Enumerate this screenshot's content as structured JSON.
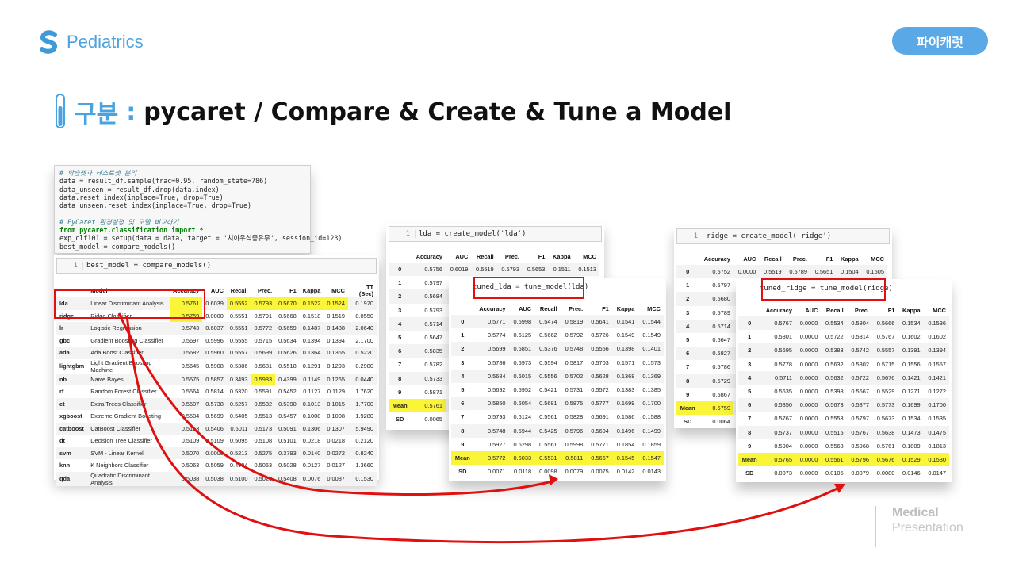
{
  "brand": {
    "name": "Pediatrics",
    "badge": "파이캐럿"
  },
  "title": {
    "category": "구분",
    "separator": ":",
    "main": "pycaret / Compare & Create & Tune a Model"
  },
  "footer": {
    "line1": "Medical",
    "line2": "Presentation"
  },
  "code_setup": [
    "# 학습셋과 테스트셋 분리",
    "data = result_df.sample(frac=0.95, random_state=786)",
    "data_unseen = result_df.drop(data.index)",
    "data.reset_index(inplace=True, drop=True)",
    "data_unseen.reset_index(inplace=True, drop=True)",
    "",
    "# PyCaret 환경설정 및 모델 비교하기",
    "from pycaret.classification import *",
    "exp_clf101 = setup(data = data, target = '치아우식증유무', session_id=123)",
    "best_model = compare_models()"
  ],
  "compare": {
    "cell_number": "1",
    "cell": "best_model = compare_models()",
    "columns": [
      "Model",
      "Accuracy",
      "AUC",
      "Recall",
      "Prec.",
      "F1",
      "Kappa",
      "MCC",
      "TT (Sec)"
    ],
    "rows": [
      [
        "lda",
        "Linear Discriminant Analysis",
        "0.5761",
        "0.6039",
        "0.5552",
        "0.5793",
        "0.5670",
        "0.1522",
        "0.1524",
        "0.1970"
      ],
      [
        "ridge",
        "Ridge Classifier",
        "0.5759",
        "0.0000",
        "0.5551",
        "0.5791",
        "0.5668",
        "0.1518",
        "0.1519",
        "0.0550"
      ],
      [
        "lr",
        "Logistic Regression",
        "0.5743",
        "0.6037",
        "0.5551",
        "0.5772",
        "0.5659",
        "0.1487",
        "0.1488",
        "2.0640"
      ],
      [
        "gbc",
        "Gradient Boosting Classifier",
        "0.5697",
        "0.5996",
        "0.5555",
        "0.5715",
        "0.5634",
        "0.1394",
        "0.1394",
        "2.1700"
      ],
      [
        "ada",
        "Ada Boost Classifier",
        "0.5682",
        "0.5960",
        "0.5557",
        "0.5699",
        "0.5626",
        "0.1364",
        "0.1365",
        "0.5220"
      ],
      [
        "lightgbm",
        "Light Gradient Boosting Machine",
        "0.5645",
        "0.5908",
        "0.5386",
        "0.5681",
        "0.5518",
        "0.1291",
        "0.1293",
        "0.2980"
      ],
      [
        "nb",
        "Naive Bayes",
        "0.5575",
        "0.5857",
        "0.3493",
        "0.5983",
        "0.4399",
        "0.1149",
        "0.1265",
        "0.0440"
      ],
      [
        "rf",
        "Random Forest Classifier",
        "0.5564",
        "0.5814",
        "0.5320",
        "0.5591",
        "0.5452",
        "0.1127",
        "0.1129",
        "1.7620"
      ],
      [
        "et",
        "Extra Trees Classifier",
        "0.5507",
        "0.5738",
        "0.5257",
        "0.5532",
        "0.5390",
        "0.1013",
        "0.1015",
        "1.7700"
      ],
      [
        "xgboost",
        "Extreme Gradient Boosting",
        "0.5504",
        "0.5699",
        "0.5405",
        "0.5513",
        "0.5457",
        "0.1008",
        "0.1008",
        "1.9280"
      ],
      [
        "catboost",
        "CatBoost Classifier",
        "0.5153",
        "0.5406",
        "0.5011",
        "0.5173",
        "0.5091",
        "0.1306",
        "0.1307",
        "5.9490"
      ],
      [
        "dt",
        "Decision Tree Classifier",
        "0.5109",
        "0.5109",
        "0.5095",
        "0.5108",
        "0.5101",
        "0.0218",
        "0.0218",
        "0.2120"
      ],
      [
        "svm",
        "SVM - Linear Kernel",
        "0.5070",
        "0.0000",
        "0.5213",
        "0.5275",
        "0.3793",
        "0.0140",
        "0.0272",
        "0.8240"
      ],
      [
        "knn",
        "K Neighbors Classifier",
        "0.5063",
        "0.5059",
        "0.4994",
        "0.5063",
        "0.5028",
        "0.0127",
        "0.0127",
        "1.3660"
      ],
      [
        "qda",
        "Quadratic Discriminant Analysis",
        "0.5038",
        "0.5038",
        "0.5100",
        "0.5020",
        "0.5408",
        "0.0076",
        "0.0087",
        "0.1530"
      ]
    ]
  },
  "create_lda": {
    "cell_number": "1",
    "cell": "lda = create_model('lda')",
    "columns": [
      "Accuracy",
      "AUC",
      "Recall",
      "Prec.",
      "F1",
      "Kappa",
      "MCC"
    ],
    "rows": [
      [
        "0",
        "0.5756",
        "0.6019",
        "0.5519",
        "0.5793",
        "0.5653",
        "0.1511",
        "0.1513"
      ],
      [
        "1",
        "0.5797"
      ],
      [
        "2",
        "0.5684"
      ],
      [
        "3",
        "0.5793"
      ],
      [
        "4",
        "0.5714"
      ],
      [
        "5",
        "0.5647"
      ],
      [
        "6",
        "0.5835"
      ],
      [
        "7",
        "0.5782"
      ],
      [
        "8",
        "0.5733"
      ],
      [
        "9",
        "0.5871"
      ],
      [
        "Mean",
        "0.5761"
      ],
      [
        "SD",
        "0.0065"
      ]
    ]
  },
  "tune_lda": {
    "cell": "tuned_lda = tune_model(lda)",
    "columns": [
      "Accuracy",
      "AUC",
      "Recall",
      "Prec.",
      "F1",
      "Kappa",
      "MCC"
    ],
    "rows": [
      [
        "0",
        "0.5771",
        "0.5998",
        "0.5474",
        "0.5819",
        "0.5641",
        "0.1541",
        "0.1544"
      ],
      [
        "1",
        "0.5774",
        "0.6125",
        "0.5662",
        "0.5792",
        "0.5726",
        "0.1549",
        "0.1549"
      ],
      [
        "2",
        "0.5699",
        "0.5851",
        "0.5376",
        "0.5748",
        "0.5556",
        "0.1398",
        "0.1401"
      ],
      [
        "3",
        "0.5786",
        "0.5973",
        "0.5594",
        "0.5817",
        "0.5703",
        "0.1571",
        "0.1573"
      ],
      [
        "4",
        "0.5684",
        "0.6015",
        "0.5556",
        "0.5702",
        "0.5628",
        "0.1368",
        "0.1369"
      ],
      [
        "5",
        "0.5692",
        "0.5952",
        "0.5421",
        "0.5731",
        "0.5572",
        "0.1383",
        "0.1385"
      ],
      [
        "6",
        "0.5850",
        "0.6054",
        "0.5681",
        "0.5875",
        "0.5777",
        "0.1699",
        "0.1700"
      ],
      [
        "7",
        "0.5793",
        "0.6124",
        "0.5561",
        "0.5828",
        "0.5691",
        "0.1586",
        "0.1588"
      ],
      [
        "8",
        "0.5748",
        "0.5944",
        "0.5425",
        "0.5796",
        "0.5604",
        "0.1496",
        "0.1499"
      ],
      [
        "9",
        "0.5927",
        "0.6298",
        "0.5561",
        "0.5998",
        "0.5771",
        "0.1854",
        "0.1859"
      ],
      [
        "Mean",
        "0.5772",
        "0.6033",
        "0.5531",
        "0.5811",
        "0.5667",
        "0.1545",
        "0.1547"
      ],
      [
        "SD",
        "0.0071",
        "0.0118",
        "0.0098",
        "0.0079",
        "0.0075",
        "0.0142",
        "0.0143"
      ]
    ]
  },
  "create_ridge": {
    "cell_number": "1",
    "cell": "ridge = create_model('ridge')",
    "columns": [
      "Accuracy",
      "AUC",
      "Recall",
      "Prec.",
      "F1",
      "Kappa",
      "MCC"
    ],
    "rows": [
      [
        "0",
        "0.5752",
        "0.0000",
        "0.5519",
        "0.5789",
        "0.5651",
        "0.1504",
        "0.1505"
      ],
      [
        "1",
        "0.5797"
      ],
      [
        "2",
        "0.5680"
      ],
      [
        "3",
        "0.5789"
      ],
      [
        "4",
        "0.5714"
      ],
      [
        "5",
        "0.5647"
      ],
      [
        "6",
        "0.5827"
      ],
      [
        "7",
        "0.5786"
      ],
      [
        "8",
        "0.5729"
      ],
      [
        "9",
        "0.5867"
      ],
      [
        "Mean",
        "0.5759"
      ],
      [
        "SD",
        "0.0064"
      ]
    ]
  },
  "tune_ridge": {
    "cell": "tuned_ridge = tune_model(ridge)",
    "columns": [
      "Accuracy",
      "AUC",
      "Recall",
      "Prec.",
      "F1",
      "Kappa",
      "MCC"
    ],
    "rows": [
      [
        "0",
        "0.5767",
        "0.0000",
        "0.5534",
        "0.5804",
        "0.5666",
        "0.1534",
        "0.1536"
      ],
      [
        "1",
        "0.5801",
        "0.0000",
        "0.5722",
        "0.5814",
        "0.5767",
        "0.1602",
        "0.1602"
      ],
      [
        "2",
        "0.5695",
        "0.0000",
        "0.5383",
        "0.5742",
        "0.5557",
        "0.1391",
        "0.1394"
      ],
      [
        "3",
        "0.5778",
        "0.0000",
        "0.5632",
        "0.5802",
        "0.5715",
        "0.1556",
        "0.1557"
      ],
      [
        "4",
        "0.5711",
        "0.0000",
        "0.5632",
        "0.5722",
        "0.5676",
        "0.1421",
        "0.1421"
      ],
      [
        "5",
        "0.5635",
        "0.0000",
        "0.5398",
        "0.5667",
        "0.5529",
        "0.1271",
        "0.1272"
      ],
      [
        "6",
        "0.5850",
        "0.0000",
        "0.5673",
        "0.5877",
        "0.5773",
        "0.1699",
        "0.1700"
      ],
      [
        "7",
        "0.5767",
        "0.0000",
        "0.5553",
        "0.5797",
        "0.5673",
        "0.1534",
        "0.1535"
      ],
      [
        "8",
        "0.5737",
        "0.0000",
        "0.5515",
        "0.5767",
        "0.5638",
        "0.1473",
        "0.1475"
      ],
      [
        "9",
        "0.5904",
        "0.0000",
        "0.5568",
        "0.5968",
        "0.5761",
        "0.1809",
        "0.1813"
      ],
      [
        "Mean",
        "0.5765",
        "0.0000",
        "0.5561",
        "0.5796",
        "0.5676",
        "0.1529",
        "0.1530"
      ],
      [
        "SD",
        "0.0073",
        "0.0000",
        "0.0105",
        "0.0079",
        "0.0080",
        "0.0146",
        "0.0147"
      ]
    ]
  },
  "colors": {
    "accent": "#4aa3df",
    "highlight": "#fbf53a",
    "annotation": "#e01010"
  }
}
